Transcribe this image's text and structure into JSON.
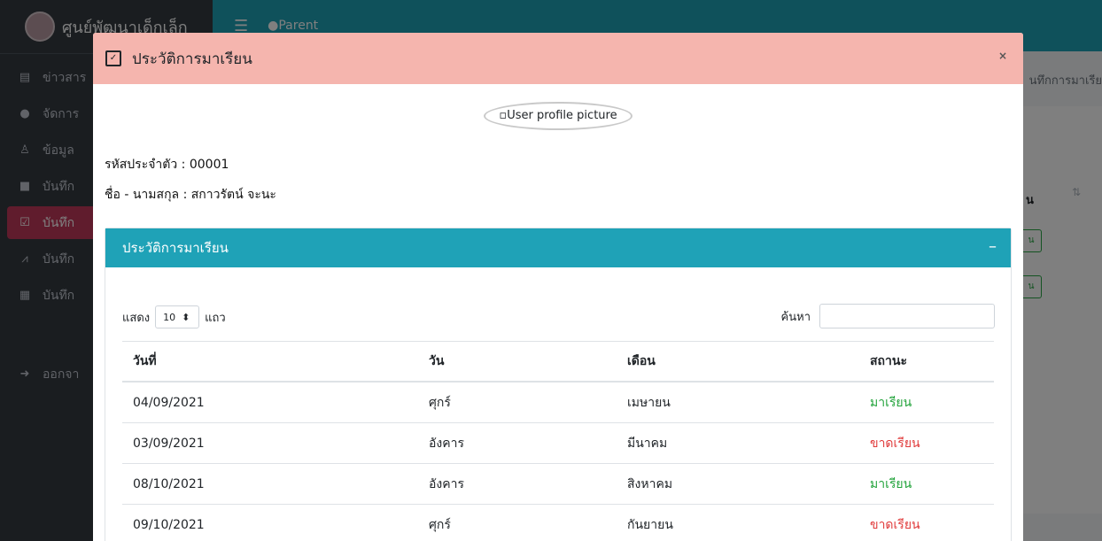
{
  "background": {
    "brand": "ศูนย์พัฒนาเด็กเล็ก",
    "topbar_user": "Parent",
    "sidebar_items": [
      {
        "label": "ข่าวสาร",
        "icon": "newspaper-icon"
      },
      {
        "label": "จัดการ",
        "icon": "user-circle-icon"
      },
      {
        "label": "ข้อมูล",
        "icon": "child-icon"
      },
      {
        "label": "บันทึก",
        "icon": "card-icon"
      },
      {
        "label": "บันทึก",
        "icon": "calendar-check-icon"
      },
      {
        "label": "บันทึก",
        "icon": "chart-line-icon"
      },
      {
        "label": "บันทึก",
        "icon": "clipboard-icon"
      }
    ],
    "logout": "ออกจา",
    "breadcrumb": "นทึกการมาเรีย",
    "table_header": "น",
    "badge": "น"
  },
  "modal": {
    "title": "ประวัติการมาเรียน",
    "close": "×",
    "photo_alt": "User profile picture",
    "student_id": "รหัสประจำตัว : 00001",
    "student_name": "ชื่อ - นามสกุล : สกาวรัตน์ จะนะ",
    "card_title": "ประวัติการมาเรียน",
    "collapse": "–",
    "length_prefix": "แสดง",
    "length_value": "10",
    "length_suffix": "แถว",
    "search_label": "ค้นหา",
    "columns": [
      "วันที่",
      "วัน",
      "เดือน",
      "สถานะ"
    ],
    "rows": [
      {
        "date": "04/09/2021",
        "day": "ศุกร์",
        "month": "เมษายน",
        "status": "มาเรียน",
        "present": true
      },
      {
        "date": "03/09/2021",
        "day": "อังคาร",
        "month": "มีนาคม",
        "status": "ขาดเรียน",
        "present": false
      },
      {
        "date": "08/10/2021",
        "day": "อังคาร",
        "month": "สิงหาคม",
        "status": "มาเรียน",
        "present": true
      },
      {
        "date": "09/10/2021",
        "day": "ศุกร์",
        "month": "กันยายน",
        "status": "ขาดเรียน",
        "present": false
      }
    ]
  },
  "colors": {
    "header_bg": "#f5b5ae",
    "card_header": "#1fa2b7",
    "present": "#22a33b",
    "absent": "#e03a3a",
    "sidebar_active": "#c0395b"
  }
}
